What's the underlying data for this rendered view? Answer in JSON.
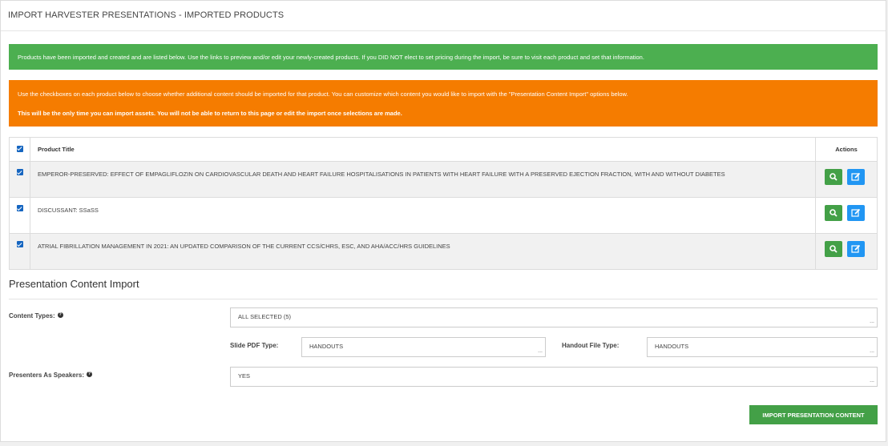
{
  "page": {
    "title": "IMPORT HARVESTER PRESENTATIONS - IMPORTED PRODUCTS"
  },
  "alerts": {
    "success": "Products have been imported and created and are listed below. Use the links to preview and/or edit your newly-created products. If you DID NOT elect to set pricing during the import, be sure to visit each product and set that information.",
    "warning_line1": "Use the checkboxes on each product below to choose whether additional content should be imported for that product. You can customize which content you would like to import with the \"Presentation Content Import\" options below.",
    "warning_line2": "This will be the only time you can import assets. You will not be able to return to this page or edit the import once selections are made."
  },
  "table": {
    "headers": {
      "title": "Product Title",
      "actions": "Actions"
    },
    "select_all_checked": true,
    "rows": [
      {
        "title": "EMPEROR-PRESERVED: EFFECT OF EMPAGLIFLOZIN ON CARDIOVASCULAR DEATH AND HEART FAILURE HOSPITALISATIONS IN PATIENTS WITH HEART FAILURE WITH A PRESERVED EJECTION FRACTION, WITH AND WITHOUT DIABETES",
        "checked": true
      },
      {
        "title": "DISCUSSANT: SSaSS",
        "checked": true
      },
      {
        "title": "ATRIAL FIBRILLATION MANAGEMENT IN 2021: AN UPDATED COMPARISON OF THE CURRENT CCS/CHRS, ESC, AND AHA/ACC/HRS GUIDELINES",
        "checked": true
      }
    ],
    "action_icons": [
      "search-icon",
      "edit-icon"
    ]
  },
  "content_import": {
    "section_title": "Presentation Content Import",
    "content_types_label": "Content Types:",
    "content_types_value": "ALL SELECTED (5)",
    "slide_pdf_label": "Slide PDF Type:",
    "slide_pdf_value": "HANDOUTS",
    "handout_file_label": "Handout File Type:",
    "handout_file_value": "HANDOUTS",
    "presenters_label": "Presenters As Speakers:",
    "presenters_value": "YES",
    "dots": "...",
    "help_icon": "?",
    "import_button": "IMPORT PRESENTATION CONTENT"
  },
  "colors": {
    "success": "#4caf50",
    "warning": "#f57c00",
    "checkbox": "#1565c0",
    "search_button": "#43a047",
    "edit_button": "#2196f3"
  }
}
